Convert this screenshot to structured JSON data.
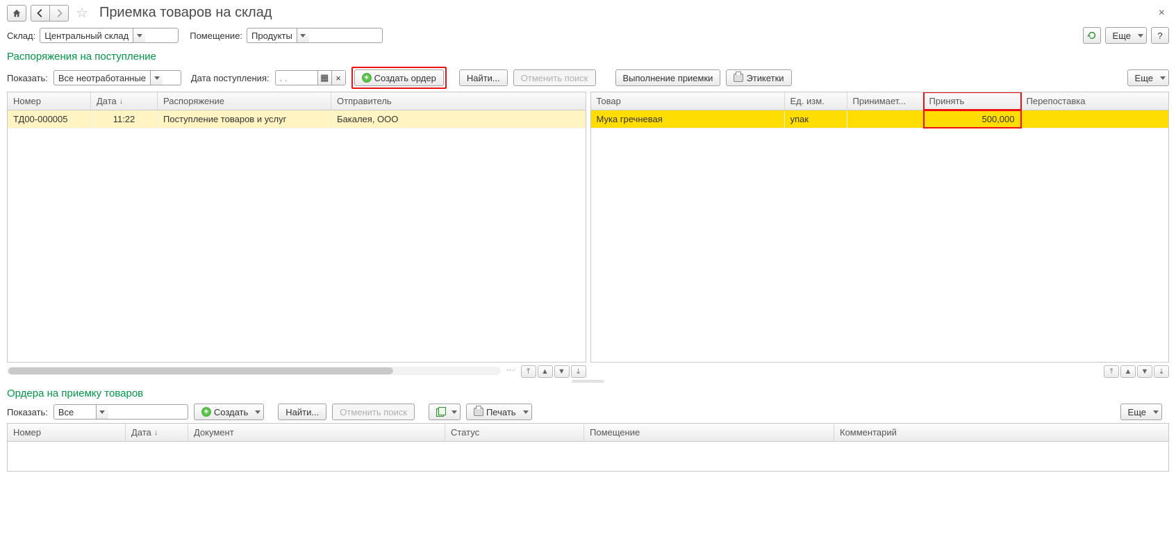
{
  "title": "Приемка товаров на склад",
  "close_symbol": "×",
  "filters": {
    "warehouse_label": "Склад:",
    "warehouse_value": "Центральный склад",
    "room_label": "Помещение:",
    "room_value": "Продукты",
    "more_label": "Еще",
    "help_label": "?"
  },
  "section1": {
    "title": "Распоряжения на поступление",
    "show_label": "Показать:",
    "show_value": "Все неотработанные",
    "date_label": "Дата поступления:",
    "date_value": ".  .",
    "create_order": "Создать ордер",
    "find": "Найти...",
    "cancel_search": "Отменить поиск",
    "receiving": "Выполнение приемки",
    "labels": "Этикетки",
    "more": "Еще"
  },
  "left_table": {
    "columns": {
      "number": "Номер",
      "date": "Дата",
      "order": "Распоряжение",
      "sender": "Отправитель"
    },
    "rows": [
      {
        "number": "ТД00-000005",
        "date": "11:22",
        "order": "Поступление товаров и услуг",
        "sender": "Бакалея, ООО"
      }
    ]
  },
  "right_table": {
    "columns": {
      "product": "Товар",
      "unit": "Ед. изм.",
      "receiving": "Принимает...",
      "accept": "Принять",
      "redelivery": "Перепоставка"
    },
    "rows": [
      {
        "product": "Мука гречневая",
        "unit": "упак",
        "receiving": "",
        "accept": "500,000",
        "redelivery": ""
      }
    ]
  },
  "section2": {
    "title": "Ордера на приемку товаров",
    "show_label": "Показать:",
    "show_value": "Все",
    "create": "Создать",
    "find": "Найти...",
    "cancel_search": "Отменить поиск",
    "print": "Печать",
    "more": "Еще"
  },
  "orders_table": {
    "columns": {
      "number": "Номер",
      "date": "Дата",
      "document": "Документ",
      "status": "Статус",
      "room": "Помещение",
      "comment": "Комментарий"
    }
  },
  "glyphs": {
    "home": "⌂",
    "back": "←",
    "forward": "→",
    "star": "☆",
    "sort_down": "↓",
    "cal": "▦",
    "clear": "×",
    "dots": "⋯",
    "mini_top": "⤒",
    "mini_up": "▲",
    "mini_down": "▼",
    "mini_bottom": "⤓"
  }
}
